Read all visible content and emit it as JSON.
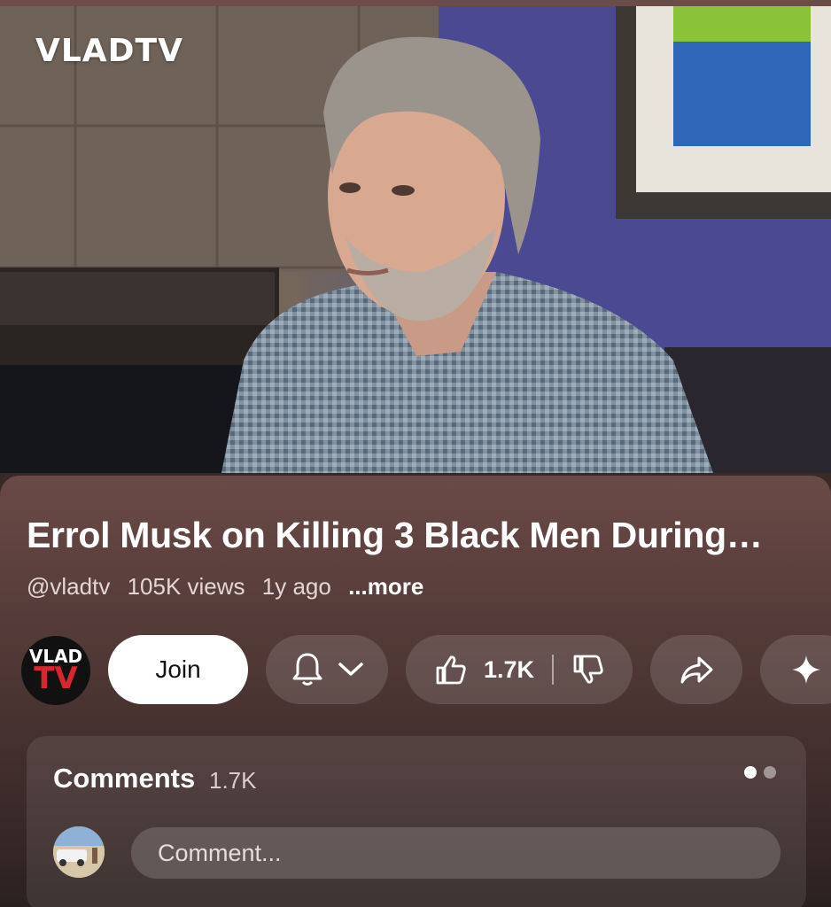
{
  "player": {
    "watermark": "VLADTV",
    "progress_fraction": 0.08
  },
  "video": {
    "title": "Errol Musk on Killing 3 Black Men During…",
    "channel_handle": "@vladtv",
    "views": "105K views",
    "age": "1y ago",
    "more_label": "...more"
  },
  "channel_avatar": {
    "line1": "VLAD",
    "line2": "TV"
  },
  "actions": {
    "join_label": "Join",
    "like_count": "1.7K"
  },
  "comments": {
    "heading": "Comments",
    "count": "1.7K",
    "placeholder": "Comment..."
  },
  "icons": [
    "bell-icon",
    "chevron-down-icon",
    "thumbs-up-icon",
    "thumbs-down-icon",
    "share-icon",
    "sparkle-icon"
  ],
  "colors": {
    "panel": "#573d3a",
    "join_bg": "#ffffff",
    "tv_red": "#d8262e"
  }
}
